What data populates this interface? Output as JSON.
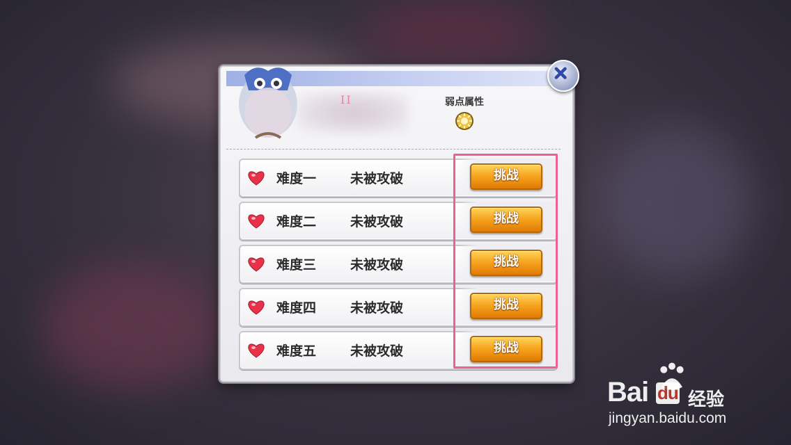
{
  "dialog": {
    "title_mark": "II",
    "weakness_label": "弱点属性",
    "weakness_icon": "sun-element-icon",
    "close_icon": "close-icon"
  },
  "difficulties": [
    {
      "level": "难度一",
      "status": "未被攻破",
      "button": "挑战"
    },
    {
      "level": "难度二",
      "status": "未被攻破",
      "button": "挑战"
    },
    {
      "level": "难度三",
      "status": "未被攻破",
      "button": "挑战"
    },
    {
      "level": "难度四",
      "status": "未被攻破",
      "button": "挑战"
    },
    {
      "level": "难度五",
      "status": "未被攻破",
      "button": "挑战"
    }
  ],
  "watermark": {
    "brand": "Bai",
    "brand2": "du",
    "sub": "经验",
    "url": "jingyan.baidu.com"
  },
  "colors": {
    "highlight": "#ef5f8f",
    "button": "#f6a21c",
    "heart": "#e8324a"
  }
}
